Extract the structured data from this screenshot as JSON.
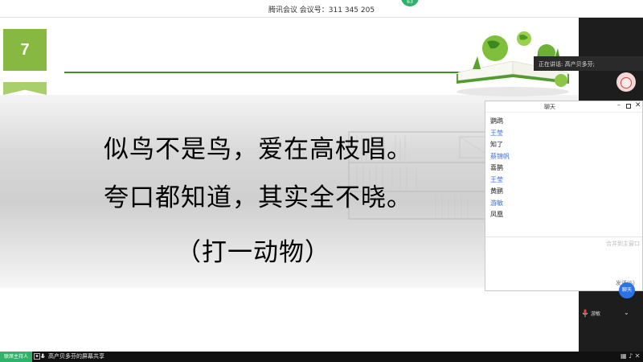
{
  "topbar": {
    "meeting_title": "腾讯会议  会议号：311 345 205",
    "timer_badge": "63"
  },
  "slide": {
    "number": "7",
    "riddle_line_1": "似鸟不是鸟，爱在高枝唱。",
    "riddle_line_2": "夸口都知道，其实全不晓。",
    "riddle_hint": "（打一动物）"
  },
  "sidebar": {
    "speaker_banner": "正在讲话: 高产贝多芬;",
    "participant_name": "游敏"
  },
  "chat": {
    "title": "聊天",
    "messages": [
      {
        "text": "鹦鹉",
        "sender": false
      },
      {
        "text": "王莹",
        "sender": true
      },
      {
        "text": "知了",
        "sender": false
      },
      {
        "text": "蔡锦帆",
        "sender": true
      },
      {
        "text": "喜鹊",
        "sender": false
      },
      {
        "text": "王莹",
        "sender": true
      },
      {
        "text": "黄鹂",
        "sender": false
      },
      {
        "text": "游敏",
        "sender": true
      },
      {
        "text": "凤凰",
        "sender": false
      }
    ],
    "merge_hint": "合并到主窗口",
    "send_label": "发送(S)",
    "fab_label": "聊天"
  },
  "bottombar": {
    "host_badge": "联席主持人",
    "share_label": "高产贝多芬的屏幕共享"
  },
  "colors": {
    "accent_green": "#86b842",
    "title_rule": "#3e8e2a",
    "sender_blue": "#3b6fd6",
    "host_green": "#2fb36b"
  }
}
